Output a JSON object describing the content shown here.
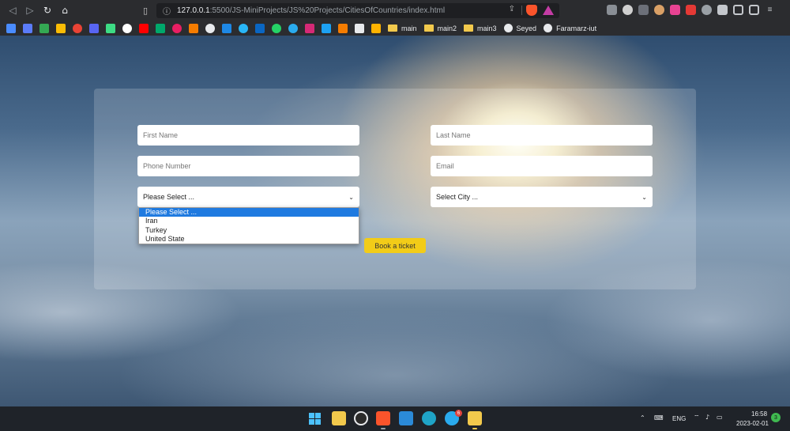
{
  "browser": {
    "nav": {
      "back": "◁",
      "forward": "▷",
      "reload": "↻",
      "home": "⌂"
    },
    "url": {
      "host": "127.0.0.1",
      "rest": ":5500/JS-MiniProjects/JS%20Projects/CitiesOfCountries/index.html"
    },
    "bookmarks": [
      {
        "label": "main",
        "icon": "folder-icon"
      },
      {
        "label": "main2",
        "icon": "folder-icon"
      },
      {
        "label": "main3",
        "icon": "folder-icon"
      },
      {
        "label": "Seyed",
        "icon": "github-icon"
      },
      {
        "label": "Faramarz-iut",
        "icon": "github-icon"
      }
    ]
  },
  "form": {
    "first_name_placeholder": "First Name",
    "last_name_placeholder": "Last Name",
    "phone_placeholder": "Phone Number",
    "email_placeholder": "Email",
    "country_selected": "Please Select ...",
    "city_selected": "Select City ...",
    "country_options": [
      "Please Select ...",
      "Iran",
      "Turkey",
      "United State"
    ],
    "book_button": "Book a ticket"
  },
  "taskbar": {
    "language": "ENG",
    "time": "16:58",
    "date": "2023-02-01",
    "telegram_badge": "6",
    "notifications": "3"
  },
  "colors": {
    "accent_select": "#1f7ae0",
    "button": "#f2cc18"
  }
}
